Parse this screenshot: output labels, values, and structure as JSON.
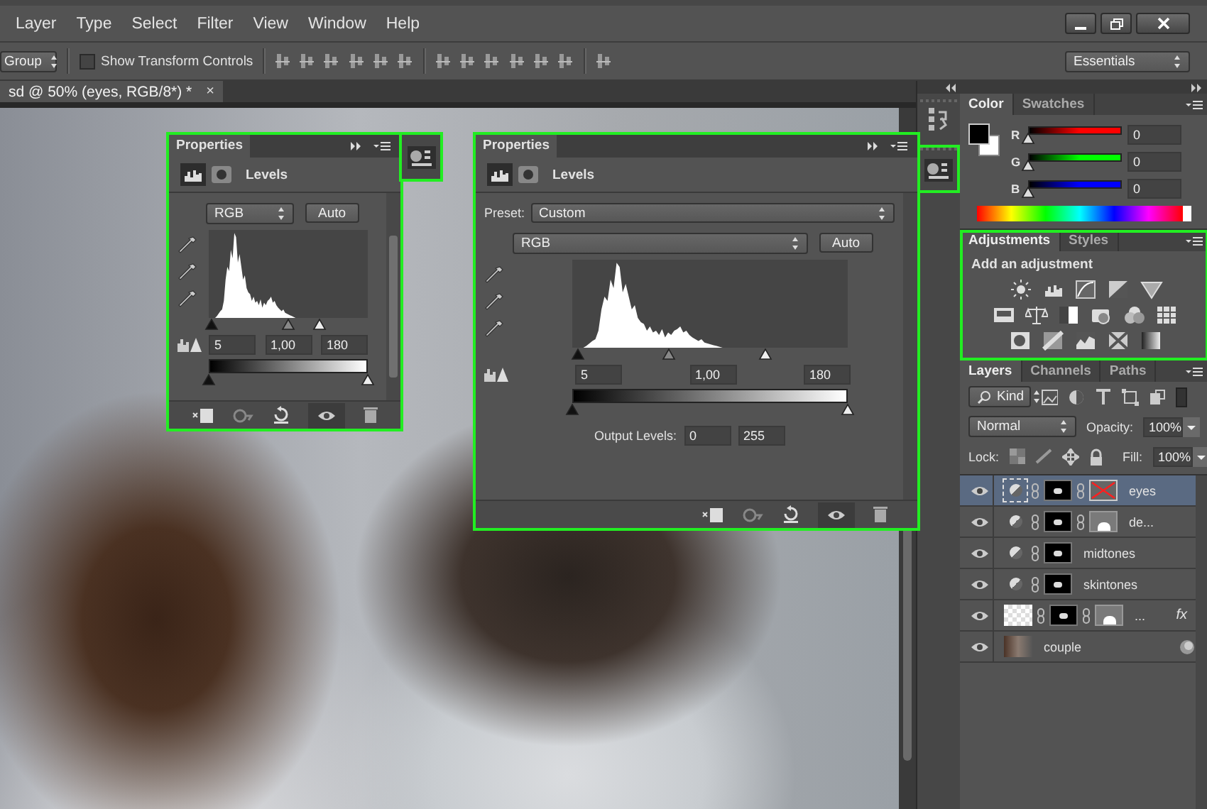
{
  "menu": [
    "Layer",
    "Type",
    "Select",
    "Filter",
    "View",
    "Window",
    "Help"
  ],
  "options_bar": {
    "group_select": "Group",
    "transform_controls": {
      "label": "Show Transform Controls",
      "checked": false
    },
    "workspace": "Essentials"
  },
  "document": {
    "tab_title": "sd @ 50% (eyes, RGB/8*) *",
    "close": "×"
  },
  "properties_panels": [
    {
      "kind": "compact",
      "title": "Properties",
      "adjustment": "Levels",
      "channel": "RGB",
      "auto": "Auto",
      "input_levels": [
        {
          "value": "5",
          "level": 0.02
        },
        {
          "value": "1,00",
          "level": 0.5
        },
        {
          "value": "180",
          "level": 0.7
        }
      ],
      "output_sliders": [
        {
          "level": 0
        },
        {
          "level": 1
        }
      ]
    },
    {
      "kind": "full",
      "title": "Properties",
      "adjustment": "Levels",
      "preset": {
        "label": "Preset:",
        "value": "Custom"
      },
      "channel": "RGB",
      "auto": "Auto",
      "input_levels": [
        {
          "value": "5",
          "level": 0.02
        },
        {
          "value": "1,00",
          "level": 0.35
        },
        {
          "value": "180",
          "level": 0.7
        }
      ],
      "output_sliders": [
        {
          "level": 0
        },
        {
          "level": 1
        }
      ],
      "output": {
        "label": "Output Levels:",
        "values": [
          "0",
          "255"
        ]
      }
    }
  ],
  "color_panel": {
    "tabs": [
      {
        "label": "Color",
        "selected": true
      },
      {
        "label": "Swatches",
        "selected": false
      }
    ],
    "channels": [
      {
        "label": "R",
        "value": "0",
        "level": 0,
        "color": "#ff0000"
      },
      {
        "label": "G",
        "value": "0",
        "level": 0,
        "color": "#00ff00"
      },
      {
        "label": "B",
        "value": "0",
        "level": 0,
        "color": "#0000ff"
      }
    ]
  },
  "adjustments_panel": {
    "tabs": [
      {
        "label": "Adjustments",
        "selected": true
      },
      {
        "label": "Styles",
        "selected": false
      }
    ],
    "heading": "Add an adjustment"
  },
  "layers_panel": {
    "tabs": [
      {
        "label": "Layers",
        "selected": true
      },
      {
        "label": "Channels",
        "selected": false
      },
      {
        "label": "Paths",
        "selected": false
      }
    ],
    "filter": "Kind",
    "blend_mode": "Normal",
    "opacity": {
      "label": "Opacity:",
      "value": "100%"
    },
    "lock_label": "Lock:",
    "fill": {
      "label": "Fill:",
      "value": "100%"
    },
    "layers": [
      {
        "name": "eyes",
        "selected": true,
        "visible": true,
        "kind": "adjustment",
        "mask": true,
        "vector_mask": true,
        "vector_mask_disabled": true
      },
      {
        "name": "de...",
        "selected": false,
        "visible": true,
        "kind": "adjustment",
        "mask": true,
        "vector_mask": true,
        "vector_mask_disabled": false
      },
      {
        "name": "midtones",
        "selected": false,
        "visible": true,
        "kind": "adjustment",
        "mask": true,
        "vector_mask": false
      },
      {
        "name": "skintones",
        "selected": false,
        "visible": true,
        "kind": "adjustment",
        "mask": true,
        "vector_mask": false
      },
      {
        "name": "...",
        "selected": false,
        "visible": true,
        "kind": "pixel",
        "mask": true,
        "vector_mask": true,
        "vector_mask_disabled": false,
        "fx": "fx"
      },
      {
        "name": "couple",
        "selected": false,
        "visible": true,
        "kind": "smart",
        "mask": false,
        "vector_mask": false
      }
    ]
  }
}
